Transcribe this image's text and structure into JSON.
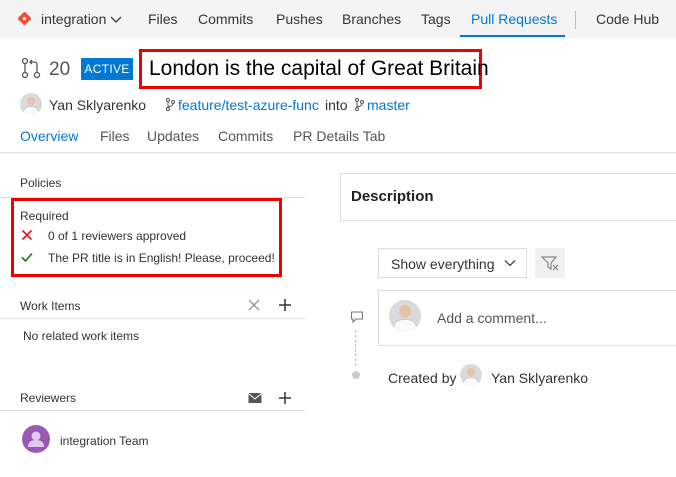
{
  "nav": {
    "repo": "integration",
    "items": [
      "Files",
      "Commits",
      "Pushes",
      "Branches",
      "Tags",
      "Pull Requests",
      "Code Hub"
    ]
  },
  "pr": {
    "number": "20",
    "status": "ACTIVE",
    "title": "London is the capital of Great Britain",
    "author": "Yan Sklyarenko",
    "source_branch": "feature/test-azure-func",
    "into": "into",
    "target_branch": "master"
  },
  "tabs": [
    "Overview",
    "Files",
    "Updates",
    "Commits",
    "PR Details Tab"
  ],
  "policies": {
    "title": "Policies",
    "required": "Required",
    "items": [
      {
        "status": "failed",
        "text": "0 of 1 reviewers approved"
      },
      {
        "status": "passed",
        "text": "The PR title is in English! Please, proceed!"
      }
    ]
  },
  "work_items": {
    "title": "Work Items",
    "empty": "No related work items"
  },
  "reviewers": {
    "title": "Reviewers",
    "items": [
      "integration Team"
    ]
  },
  "description": {
    "title": "Description"
  },
  "activity": {
    "filter": "Show everything",
    "comment_placeholder": "Add a comment...",
    "created_by": "Created by",
    "creator": "Yan Sklyarenko"
  },
  "colors": {
    "accent": "#0078d4",
    "failed": "#e81123",
    "passed": "#107c10",
    "highlight": "#e00000"
  }
}
